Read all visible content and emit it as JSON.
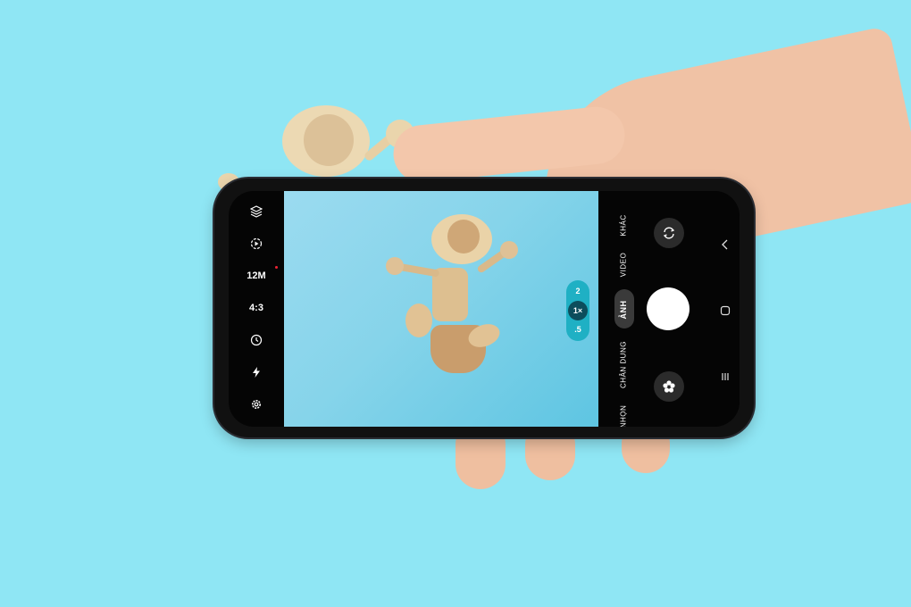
{
  "camera": {
    "left_toolbar": {
      "resolution": "12M",
      "aspect_ratio": "4:3"
    },
    "zoom": {
      "options": [
        "2",
        "1×",
        ".5"
      ],
      "selected": "1×"
    },
    "modes": {
      "more": "KHÁC",
      "video": "VIDEO",
      "photo": "ẢNH",
      "portrait": "CHÂN DUNG",
      "night": "NHỌN"
    },
    "active_mode": "ẢNH"
  },
  "icons": {
    "filters": "layers-icon",
    "motion": "motion-photo-icon",
    "timer": "timer-icon",
    "flash": "flash-icon",
    "settings": "gear-icon",
    "switch_camera": "switch-camera-icon",
    "effects": "flower-icon",
    "back": "chevron-left-icon",
    "home": "home-square-icon",
    "recents": "recents-icon"
  },
  "colors": {
    "background": "#8fe6f4",
    "zoom_accent": "#1fb0c4",
    "shutter": "#ffffff"
  }
}
